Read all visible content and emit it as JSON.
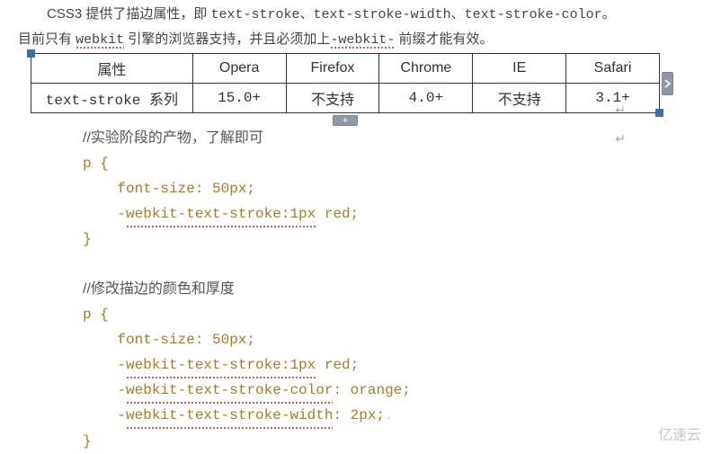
{
  "intro": {
    "line1_p1": "CSS3 提供了描边属性，即 ",
    "line1_p2": "text-stroke、text-stroke-width、text-stroke-color",
    "line1_p3": "。",
    "line2_p1": "目前只有 ",
    "line2_p2": "webkit",
    "line2_p3": " 引擎的浏览器支持，并且必须加上",
    "line2_p4": "-webkit-",
    "line2_p5": " 前缀才能有效。"
  },
  "table": {
    "headers": [
      "属性",
      "Opera",
      "Firefox",
      "Chrome",
      "IE",
      "Safari"
    ],
    "row": [
      "text-stroke 系列",
      "15.0+",
      "不支持",
      "4.0+",
      "不支持",
      "3.1+"
    ]
  },
  "code": {
    "c1": "//实验阶段的产物，了解即可",
    "sel1": "p ",
    "ob1": "{",
    "ind": "    ",
    "l1a": "font-size: 50px;",
    "l1b_pre": "-",
    "l1b_w": "webkit-text-stroke:1px",
    "l1b_post": " red;",
    "cb1": "}",
    "blank": "",
    "c2": "//修改描边的颜色和厚度",
    "sel2": "p ",
    "ob2": "{",
    "l2a": "font-size: 50px;",
    "l2b_pre": "-",
    "l2b_w": "webkit-text-stroke:1px",
    "l2b_post": " red;",
    "l2c_pre": "-",
    "l2c_w": "webkit-text-stroke-color",
    "l2c_post": ": orange;",
    "l2d_pre": "-",
    "l2d_w": "webkit-text-stroke-width",
    "l2d_post": ": 2px;",
    "cb2": "}"
  },
  "glyphs": {
    "plus": "+",
    "tri_right": "▸",
    "para": "↵"
  },
  "watermark": "亿速云"
}
